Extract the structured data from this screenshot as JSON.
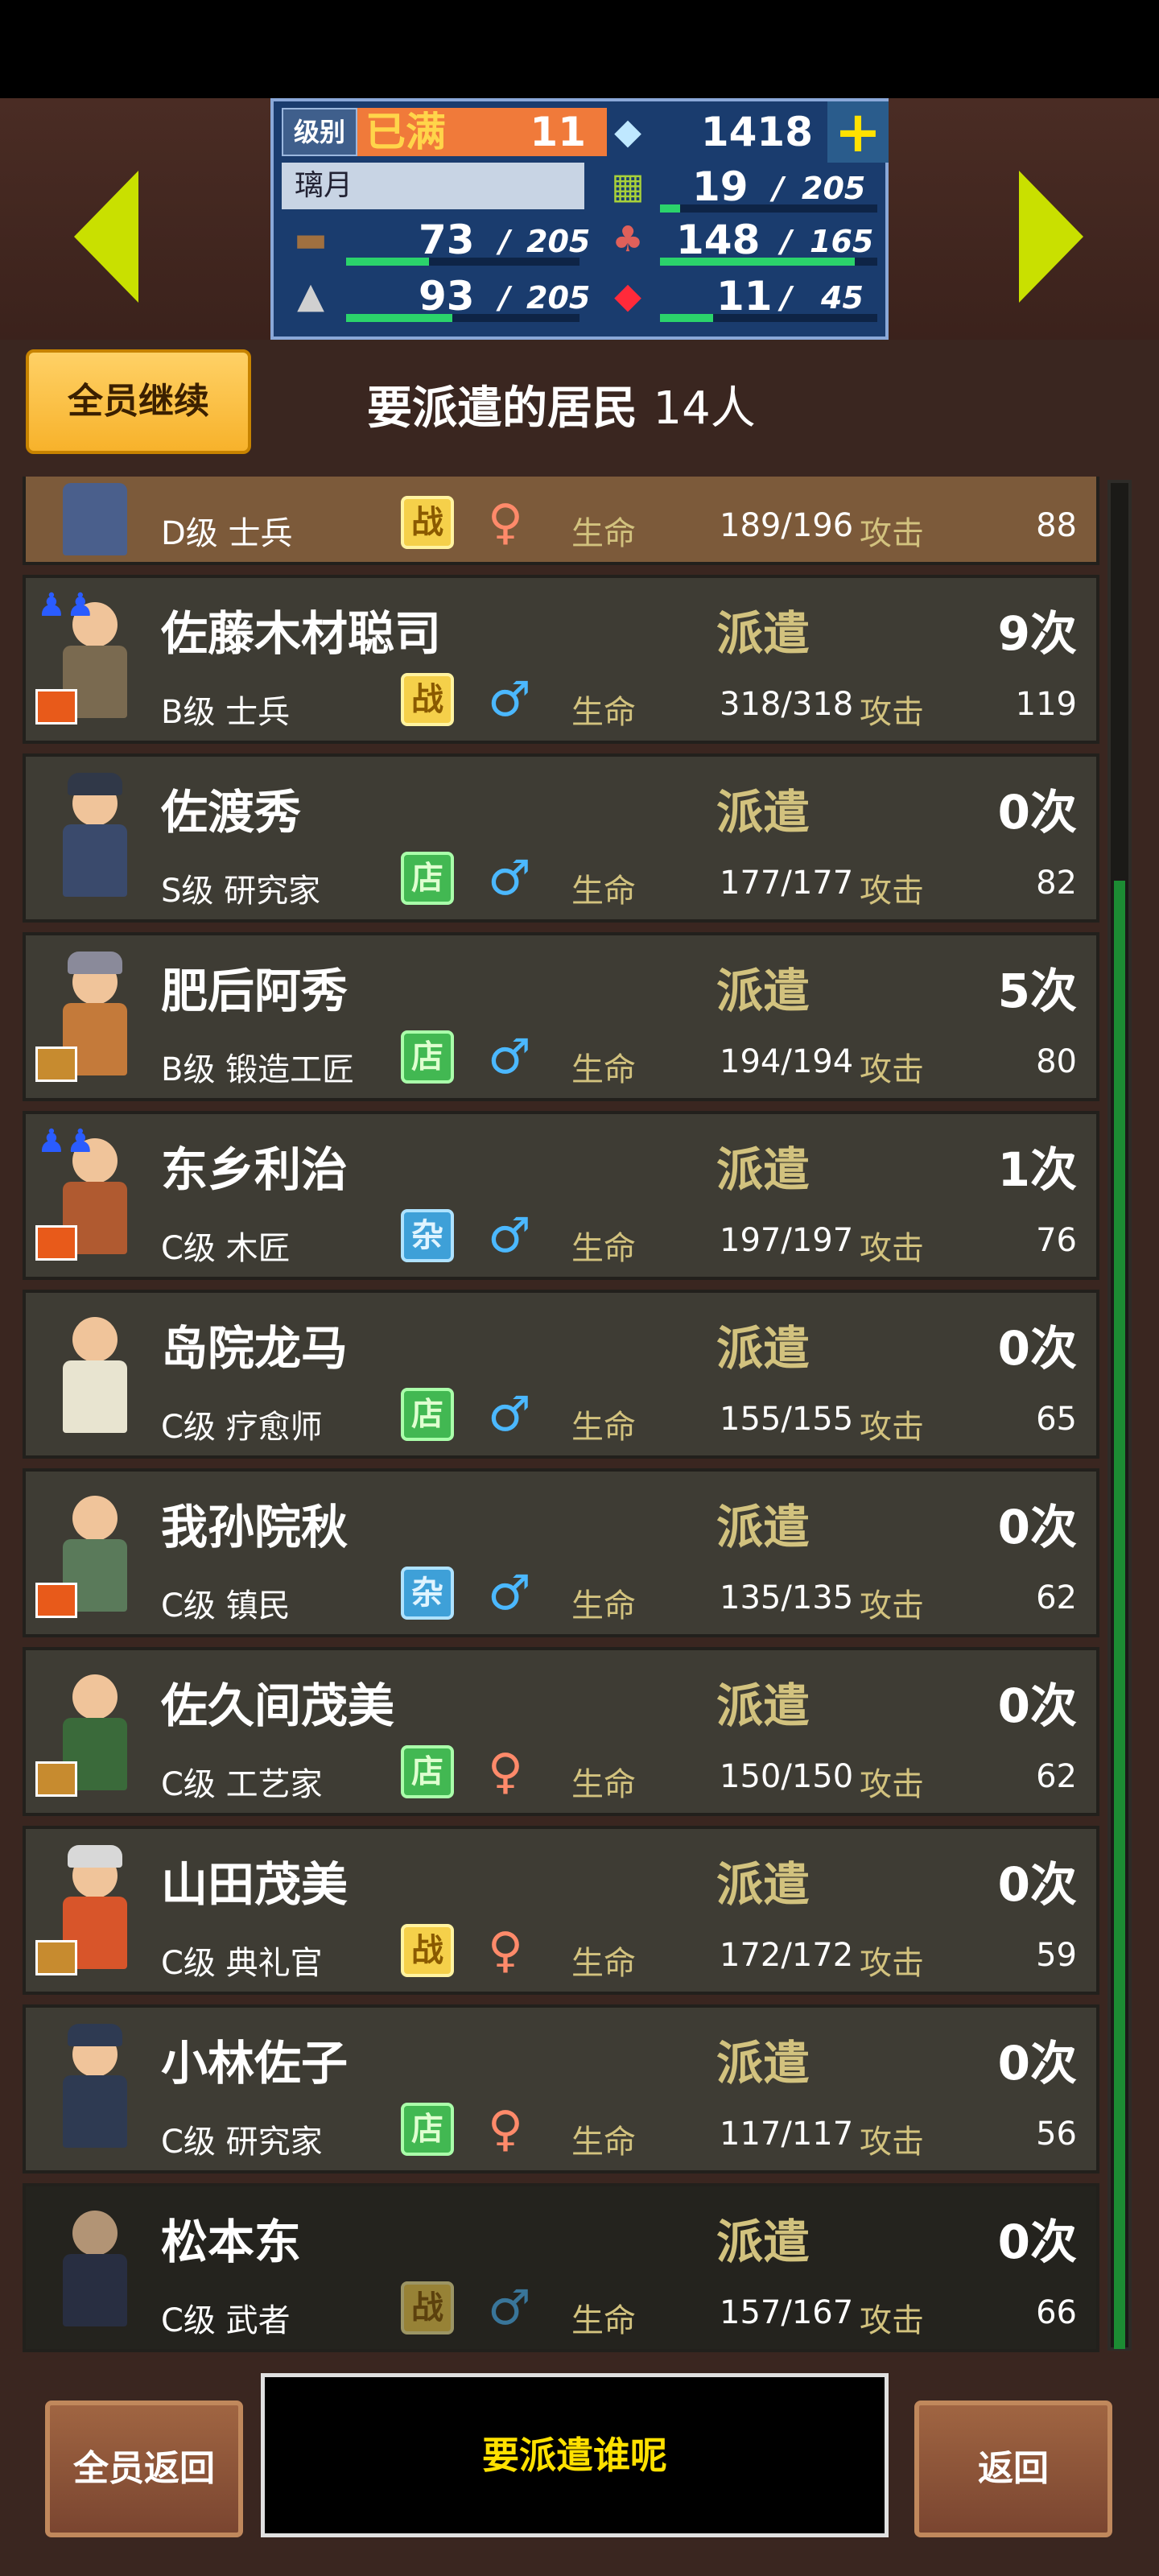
{
  "header": {
    "level_label": "级别",
    "level_status": "已满",
    "level_value": "11",
    "diamonds": "1418",
    "player_name": "璃月",
    "food_value": "19",
    "food_max": "205",
    "wood_value": "73",
    "wood_max": "205",
    "meat_value": "148",
    "meat_max": "165",
    "stone_value": "93",
    "stone_max": "205",
    "ruby_value": "11",
    "ruby_max": "45",
    "separator": "/",
    "wood_fill": 0.356,
    "food_fill": 0.093,
    "meat_fill": 0.897,
    "stone_fill": 0.454,
    "ruby_fill": 0.244
  },
  "toolbar": {
    "continue_all_label": "全员继续",
    "title": "要派遣的居民",
    "count_label": "14人"
  },
  "list": {
    "dispatch_label": "派遣",
    "life_label": "生命",
    "attack_label": "攻击",
    "residents": [
      {
        "name": "",
        "rank_job": "D级 士兵",
        "tag": "战",
        "hp": "189/196",
        "atk": "88",
        "count": ""
      },
      {
        "name": "佐藤木材聪司",
        "rank_job": "B级 士兵",
        "tag": "战",
        "hp": "318/318",
        "atk": "119",
        "count": "9次"
      },
      {
        "name": "佐渡秀",
        "rank_job": "S级 研究家",
        "tag": "店",
        "hp": "177/177",
        "atk": "82",
        "count": "0次"
      },
      {
        "name": "肥后阿秀",
        "rank_job": "B级 锻造工匠",
        "tag": "店",
        "hp": "194/194",
        "atk": "80",
        "count": "5次"
      },
      {
        "name": "东乡利治",
        "rank_job": "C级 木匠",
        "tag": "杂",
        "hp": "197/197",
        "atk": "76",
        "count": "1次"
      },
      {
        "name": "岛院龙马",
        "rank_job": "C级 疗愈师",
        "tag": "店",
        "hp": "155/155",
        "atk": "65",
        "count": "0次"
      },
      {
        "name": "我孙院秋",
        "rank_job": "C级 镇民",
        "tag": "杂",
        "hp": "135/135",
        "atk": "62",
        "count": "0次"
      },
      {
        "name": "佐久间茂美",
        "rank_job": "C级 工艺家",
        "tag": "店",
        "hp": "150/150",
        "atk": "62",
        "count": "0次"
      },
      {
        "name": "山田茂美",
        "rank_job": "C级 典礼官",
        "tag": "战",
        "hp": "172/172",
        "atk": "59",
        "count": "0次"
      },
      {
        "name": "小林佐子",
        "rank_job": "C级 研究家",
        "tag": "店",
        "hp": "117/117",
        "atk": "56",
        "count": "0次"
      },
      {
        "name": "松本东",
        "rank_job": "C级 武者",
        "tag": "战",
        "hp": "157/167",
        "atk": "66",
        "count": "0次"
      }
    ]
  },
  "footer": {
    "return_all_label": "全员返回",
    "prompt": "要派遣谁呢",
    "back_label": "返回"
  }
}
